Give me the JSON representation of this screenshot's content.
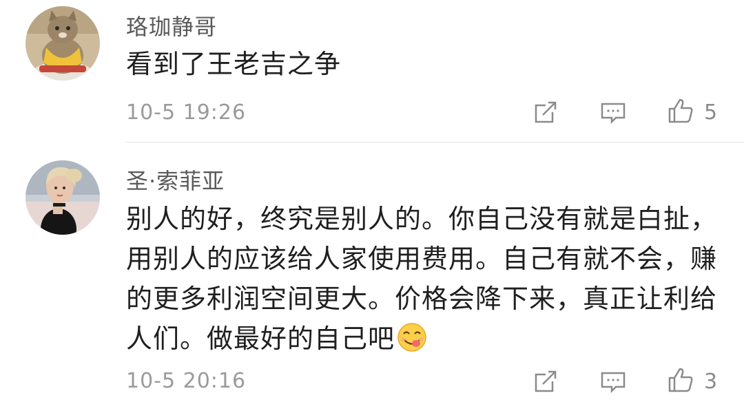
{
  "comments": [
    {
      "username": "珞珈静哥",
      "text": "看到了王老吉之争",
      "timestamp": "10-5 19:26",
      "likes": "5",
      "avatar": "cat-avatar"
    },
    {
      "username": "圣·索菲亚",
      "text": "别人的好，终究是别人的。你自己没有就是白扯，用别人的应该给人家使用费用。自己有就不会，赚的更多利润空间更大。价格会降下来，真正让利给人们。做最好的自己吧",
      "timestamp": "10-5 20:16",
      "likes": "3",
      "avatar": "woman-avatar",
      "emoji": "yummy-face-emoji"
    }
  ],
  "icons": {
    "share": "share-icon",
    "reply": "comment-icon",
    "like": "thumbs-up-icon"
  },
  "colors": {
    "username": "#5a5a5a",
    "text": "#1f1f1f",
    "meta": "#9a9a9a",
    "icon": "#8a8a8a",
    "divider": "#e6e6e6"
  }
}
